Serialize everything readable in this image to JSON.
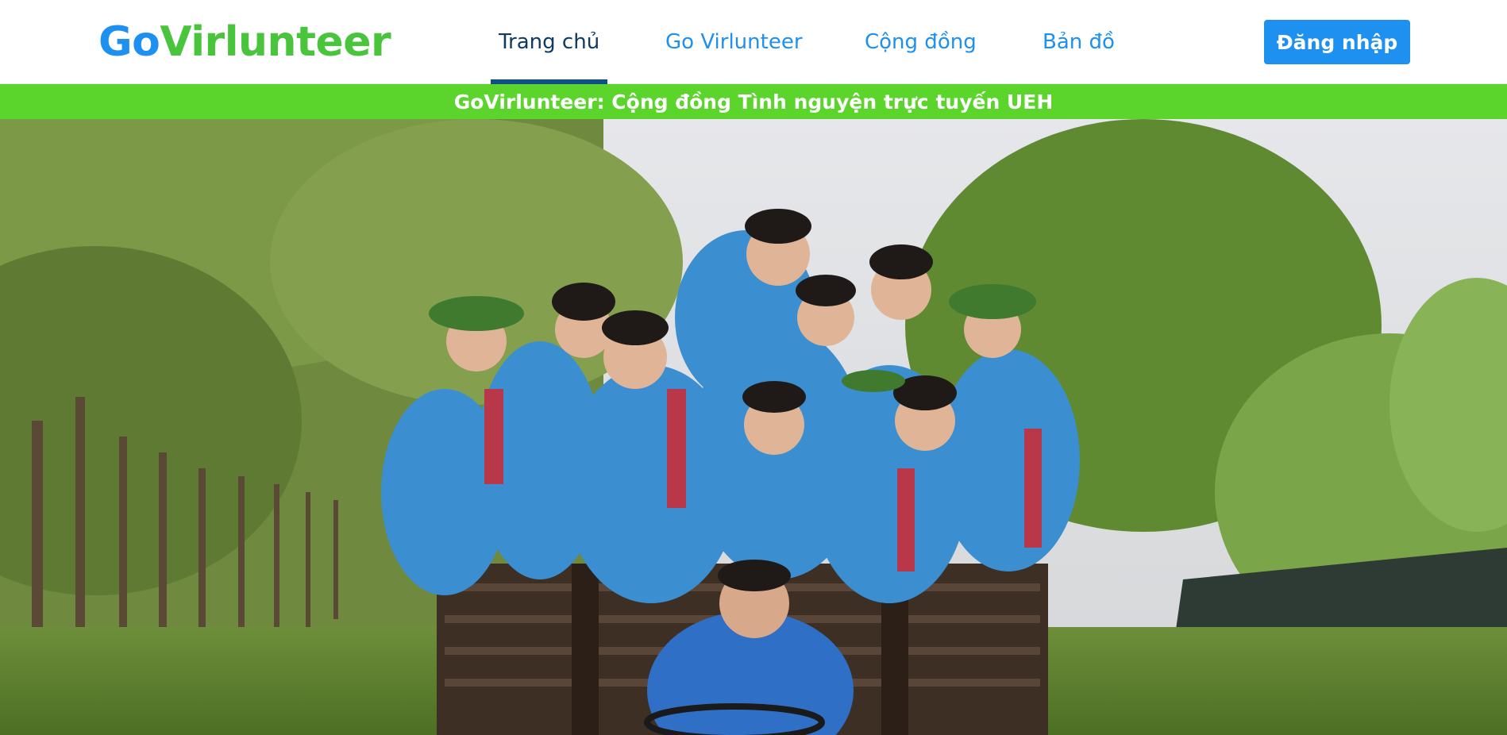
{
  "header": {
    "logo": {
      "part1": "Go",
      "part2": "Virlunteer"
    },
    "nav": [
      {
        "label": "Trang chủ",
        "active": true
      },
      {
        "label": "Go Virlunteer",
        "active": false
      },
      {
        "label": "Cộng đồng",
        "active": false
      },
      {
        "label": "Bản đồ",
        "active": false
      }
    ],
    "login_label": "Đăng nhập"
  },
  "banner": {
    "text": "GoVirlunteer: Cộng đồng Tình nguyện trực tuyến UEH"
  },
  "colors": {
    "brand_blue": "#1e90f0",
    "brand_green": "#49c43c",
    "banner_green": "#5bd42b",
    "nav_active": "#0f3b63"
  }
}
